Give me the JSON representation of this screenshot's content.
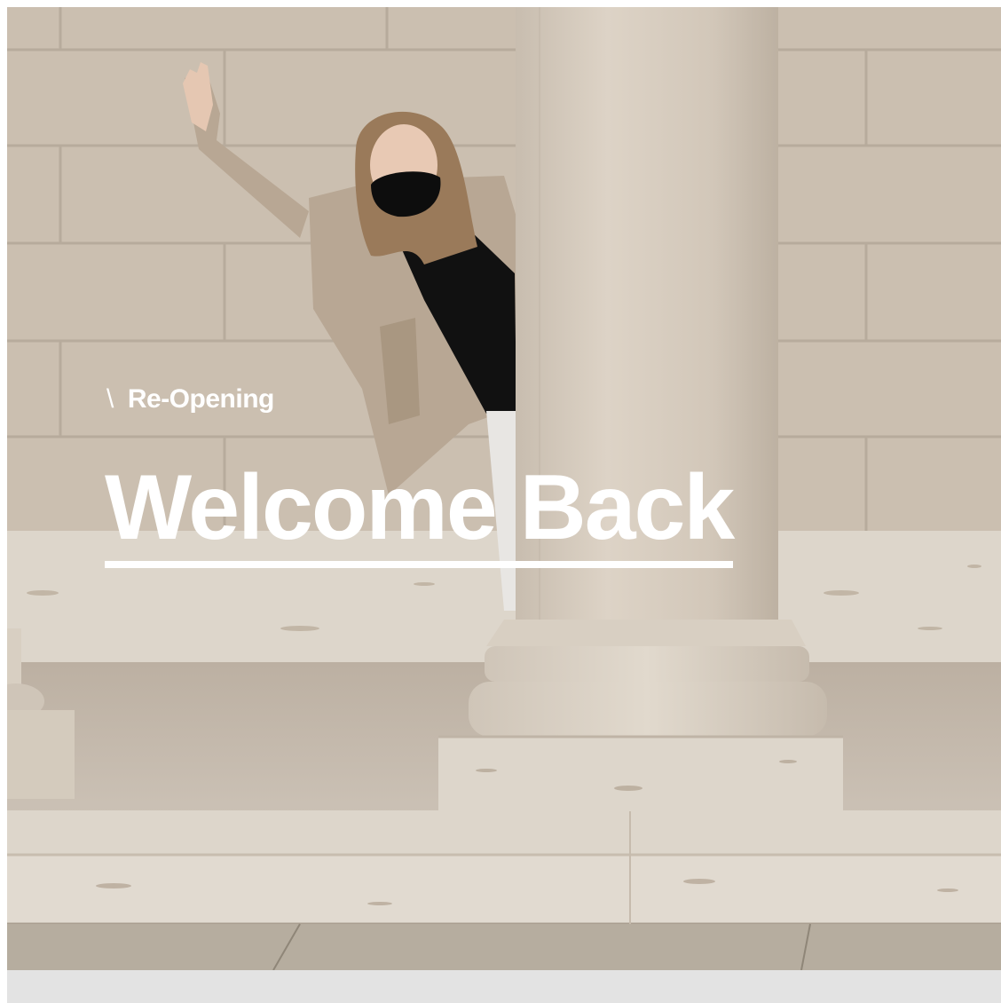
{
  "hero": {
    "eyebrow_prefix": "\\",
    "eyebrow_label": "Re-Opening",
    "headline": "Welcome Back",
    "image_description_colors": {
      "wall": "#cbbfb0",
      "column": "#d6ccbe",
      "travertine": "#ddd6cb",
      "floor": "#c4b9ab",
      "coat": "#b8a794",
      "shirt": "#111111",
      "text": "#ffffff",
      "strip": "#e3e3e3"
    }
  }
}
